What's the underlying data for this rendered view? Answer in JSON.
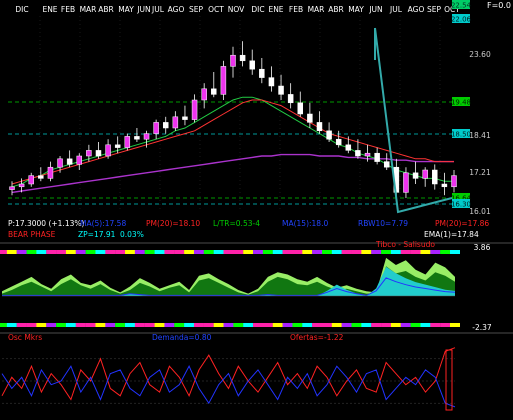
{
  "chart_data": {
    "type": "line",
    "months_top": [
      "DIC",
      "ENE",
      "FEB",
      "MAR",
      "ABR",
      "MAY",
      "JUN",
      "JUL",
      "AGO",
      "SEP",
      "OCT",
      "NOV",
      "DIC",
      "ENE",
      "FEB",
      "MAR",
      "ABR",
      "MAY",
      "JUN",
      "JUL",
      "AGO",
      "SEP",
      "OCT"
    ],
    "f_value": "F=0.0",
    "price_axis_labels": [
      "23.60",
      "18.41",
      "17.21",
      "16.01"
    ],
    "highlight_levels": [
      {
        "label": "22.54",
        "color": "#00cc66",
        "text_color": "#003322"
      },
      {
        "label": "22.06",
        "color": "#00cccc",
        "text_color": "#002222"
      },
      {
        "label": "19.48",
        "color": "#00cc00",
        "text_color": "#002200"
      },
      {
        "label": "18.50",
        "color": "#00cccc",
        "text_color": "#002222"
      },
      {
        "label": "16.64",
        "color": "#00cc00",
        "text_color": "#002200"
      },
      {
        "label": "16.30",
        "color": "#00cccc",
        "text_color": "#002222"
      }
    ],
    "price_candles": [
      {
        "o": 16.8,
        "h": 17.1,
        "l": 16.6,
        "c": 16.9
      },
      {
        "o": 16.9,
        "h": 17.2,
        "l": 16.7,
        "c": 17.0
      },
      {
        "o": 17.0,
        "h": 17.4,
        "l": 16.9,
        "c": 17.3
      },
      {
        "o": 17.3,
        "h": 17.6,
        "l": 17.1,
        "c": 17.2
      },
      {
        "o": 17.2,
        "h": 17.8,
        "l": 17.1,
        "c": 17.6
      },
      {
        "o": 17.6,
        "h": 18.0,
        "l": 17.4,
        "c": 17.9
      },
      {
        "o": 17.9,
        "h": 18.2,
        "l": 17.6,
        "c": 17.7
      },
      {
        "o": 17.7,
        "h": 18.1,
        "l": 17.5,
        "c": 18.0
      },
      {
        "o": 18.0,
        "h": 18.4,
        "l": 17.8,
        "c": 18.2
      },
      {
        "o": 18.2,
        "h": 18.5,
        "l": 17.9,
        "c": 18.0
      },
      {
        "o": 18.0,
        "h": 18.6,
        "l": 17.9,
        "c": 18.4
      },
      {
        "o": 18.4,
        "h": 18.7,
        "l": 18.1,
        "c": 18.3
      },
      {
        "o": 18.3,
        "h": 18.8,
        "l": 18.2,
        "c": 18.7
      },
      {
        "o": 18.7,
        "h": 19.0,
        "l": 18.5,
        "c": 18.6
      },
      {
        "o": 18.6,
        "h": 18.9,
        "l": 18.3,
        "c": 18.8
      },
      {
        "o": 18.8,
        "h": 19.3,
        "l": 18.6,
        "c": 19.2
      },
      {
        "o": 19.2,
        "h": 19.4,
        "l": 18.8,
        "c": 19.0
      },
      {
        "o": 19.0,
        "h": 19.6,
        "l": 18.9,
        "c": 19.4
      },
      {
        "o": 19.4,
        "h": 19.8,
        "l": 19.1,
        "c": 19.3
      },
      {
        "o": 19.3,
        "h": 20.2,
        "l": 19.2,
        "c": 20.0
      },
      {
        "o": 20.0,
        "h": 20.6,
        "l": 19.7,
        "c": 20.4
      },
      {
        "o": 20.4,
        "h": 21.0,
        "l": 20.1,
        "c": 20.2
      },
      {
        "o": 20.2,
        "h": 21.4,
        "l": 20.0,
        "c": 21.2
      },
      {
        "o": 21.2,
        "h": 21.9,
        "l": 20.8,
        "c": 21.6
      },
      {
        "o": 21.6,
        "h": 22.1,
        "l": 21.2,
        "c": 21.4
      },
      {
        "o": 21.4,
        "h": 21.8,
        "l": 20.9,
        "c": 21.1
      },
      {
        "o": 21.1,
        "h": 21.5,
        "l": 20.6,
        "c": 20.8
      },
      {
        "o": 20.8,
        "h": 21.2,
        "l": 20.3,
        "c": 20.5
      },
      {
        "o": 20.5,
        "h": 20.9,
        "l": 20.0,
        "c": 20.2
      },
      {
        "o": 20.2,
        "h": 20.6,
        "l": 19.7,
        "c": 19.9
      },
      {
        "o": 19.9,
        "h": 20.3,
        "l": 19.4,
        "c": 19.5
      },
      {
        "o": 19.5,
        "h": 19.9,
        "l": 19.0,
        "c": 19.2
      },
      {
        "o": 19.2,
        "h": 19.6,
        "l": 18.8,
        "c": 18.9
      },
      {
        "o": 18.9,
        "h": 19.2,
        "l": 18.5,
        "c": 18.6
      },
      {
        "o": 18.6,
        "h": 18.9,
        "l": 18.3,
        "c": 18.4
      },
      {
        "o": 18.4,
        "h": 18.7,
        "l": 18.1,
        "c": 18.2
      },
      {
        "o": 18.2,
        "h": 18.6,
        "l": 17.9,
        "c": 18.0
      },
      {
        "o": 18.0,
        "h": 18.4,
        "l": 17.8,
        "c": 18.1
      },
      {
        "o": 18.1,
        "h": 18.3,
        "l": 17.7,
        "c": 17.8
      },
      {
        "o": 17.8,
        "h": 18.1,
        "l": 17.5,
        "c": 17.6
      },
      {
        "o": 17.6,
        "h": 17.9,
        "l": 16.4,
        "c": 16.7
      },
      {
        "o": 16.7,
        "h": 17.6,
        "l": 16.5,
        "c": 17.4
      },
      {
        "o": 17.4,
        "h": 17.8,
        "l": 17.0,
        "c": 17.2
      },
      {
        "o": 17.2,
        "h": 17.6,
        "l": 16.9,
        "c": 17.5
      },
      {
        "o": 17.5,
        "h": 17.7,
        "l": 16.8,
        "c": 17.0
      },
      {
        "o": 17.0,
        "h": 17.4,
        "l": 16.6,
        "c": 16.9
      },
      {
        "o": 16.9,
        "h": 17.5,
        "l": 16.7,
        "c": 17.3
      }
    ],
    "ma_red": [
      17.0,
      17.1,
      17.2,
      17.3,
      17.4,
      17.5,
      17.6,
      17.7,
      17.8,
      17.9,
      18.0,
      18.1,
      18.2,
      18.3,
      18.4,
      18.5,
      18.6,
      18.7,
      18.8,
      18.9,
      19.1,
      19.3,
      19.5,
      19.7,
      19.9,
      20.0,
      20.0,
      19.9,
      19.8,
      19.6,
      19.4,
      19.2,
      19.0,
      18.8,
      18.7,
      18.6,
      18.5,
      18.4,
      18.3,
      18.2,
      18.1,
      18.0,
      17.9,
      17.9,
      17.8,
      17.8,
      17.8
    ],
    "ma_green": [
      16.9,
      17.0,
      17.2,
      17.3,
      17.5,
      17.6,
      17.7,
      17.8,
      17.9,
      18.0,
      18.1,
      18.2,
      18.3,
      18.4,
      18.5,
      18.6,
      18.7,
      18.9,
      19.0,
      19.2,
      19.4,
      19.6,
      19.8,
      20.0,
      20.1,
      20.1,
      20.0,
      19.8,
      19.6,
      19.4,
      19.2,
      19.0,
      18.8,
      18.6,
      18.4,
      18.3,
      18.1,
      18.0,
      17.9,
      17.7,
      17.5,
      17.4,
      17.3,
      17.2,
      17.2,
      17.1,
      17.1
    ],
    "ma_purple": [
      16.7,
      16.75,
      16.8,
      16.85,
      16.9,
      16.95,
      17.0,
      17.05,
      17.1,
      17.15,
      17.2,
      17.25,
      17.3,
      17.35,
      17.4,
      17.45,
      17.5,
      17.55,
      17.6,
      17.65,
      17.7,
      17.75,
      17.8,
      17.85,
      17.9,
      17.95,
      18.0,
      18.0,
      18.05,
      18.05,
      18.05,
      18.05,
      18.0,
      18.0,
      18.0,
      17.95,
      17.95,
      17.9,
      17.9,
      17.9,
      17.85,
      17.85,
      17.8,
      17.8,
      17.8,
      17.8,
      17.8
    ],
    "info_line1": [
      {
        "text": "P:17.3000 (+1.13%)",
        "color": "#ffffff"
      },
      {
        "text": "MA(5):17.58",
        "color": "#2244ff"
      },
      {
        "text": "PM(20)=18.10",
        "color": "#ff2222"
      },
      {
        "text": "L/TR=0.53-4",
        "color": "#00cc00"
      },
      {
        "text": "MA(15):18.0",
        "color": "#2244ff"
      },
      {
        "text": "RBW10=7.79",
        "color": "#2244ff"
      },
      {
        "text": "PM(20)=17.86",
        "color": "#ff2222"
      }
    ],
    "info_line2": [
      {
        "text": "BEAR PHASE",
        "color": "#ff2222"
      },
      {
        "text": "ZP=17.91",
        "color": "#00ffff"
      },
      {
        "text": "0.03%",
        "color": "#00ffff"
      },
      {
        "text": "EMA(1)=17.84",
        "color": "#ffffff"
      }
    ],
    "osc_header": {
      "text": "Tibco - Salisudo",
      "color": "#ff2222"
    },
    "osc_max": "3.86",
    "osc_min": "-2.37",
    "osc_light": [
      0.4,
      0.8,
      1.2,
      1.6,
      1.0,
      0.6,
      1.4,
      1.8,
      1.1,
      0.9,
      1.3,
      0.7,
      0.3,
      0.8,
      1.5,
      1.1,
      0.6,
      0.9,
      1.2,
      0.5,
      1.7,
      1.9,
      1.4,
      1.0,
      0.5,
      0.2,
      0.6,
      1.6,
      2.0,
      1.8,
      1.4,
      1.2,
      1.6,
      1.1,
      0.7,
      0.9,
      0.6,
      0.4,
      0.3,
      3.2,
      2.6,
      3.0,
      2.2,
      1.8,
      2.8,
      2.4,
      1.6
    ],
    "osc_dark": [
      0.2,
      0.5,
      0.9,
      1.2,
      0.8,
      0.4,
      1.0,
      1.4,
      0.9,
      0.6,
      1.0,
      0.5,
      0.2,
      0.5,
      1.1,
      0.8,
      0.4,
      0.7,
      0.9,
      0.3,
      1.3,
      1.5,
      1.1,
      0.7,
      0.3,
      0.1,
      0.4,
      1.2,
      1.6,
      1.4,
      1.0,
      0.9,
      1.2,
      0.8,
      0.5,
      0.6,
      0.4,
      0.2,
      0.2,
      2.5,
      1.9,
      2.1,
      1.6,
      1.3,
      2.0,
      1.7,
      1.2
    ],
    "osc_negative": [
      0,
      0,
      0,
      0,
      0,
      0,
      0,
      0,
      0,
      0,
      0,
      0,
      0,
      -0.2,
      -0.1,
      0,
      0,
      0,
      0,
      0,
      0,
      0,
      0,
      0,
      0,
      0,
      0,
      -0.1,
      0,
      0,
      0,
      0,
      0,
      -0.4,
      -0.9,
      -0.5,
      -0.2,
      0,
      -0.6,
      -2.3,
      -1.8,
      -1.4,
      -1.1,
      -0.9,
      -0.7,
      -0.5,
      -0.4
    ],
    "bottom_header": [
      {
        "text": "Osc Mkrs",
        "color": "#ff2222"
      },
      {
        "text": "Demanda=0.80",
        "color": "#2244ff"
      },
      {
        "text": "Ofertas=-1.22",
        "color": "#ff2222"
      }
    ],
    "bottom_red": [
      30,
      55,
      40,
      70,
      35,
      60,
      45,
      25,
      65,
      50,
      80,
      40,
      30,
      60,
      75,
      45,
      35,
      70,
      55,
      30,
      65,
      85,
      60,
      40,
      70,
      50,
      35,
      55,
      75,
      45,
      60,
      40,
      70,
      55,
      30,
      50,
      65,
      40,
      35,
      75,
      60,
      45,
      55,
      35,
      50,
      90,
      95
    ],
    "bottom_blue": [
      60,
      40,
      55,
      30,
      65,
      45,
      50,
      70,
      35,
      55,
      25,
      60,
      65,
      40,
      30,
      55,
      65,
      35,
      45,
      70,
      40,
      20,
      45,
      60,
      30,
      50,
      65,
      45,
      25,
      55,
      40,
      60,
      30,
      45,
      70,
      55,
      35,
      60,
      65,
      25,
      40,
      55,
      45,
      65,
      55,
      20,
      15
    ]
  }
}
